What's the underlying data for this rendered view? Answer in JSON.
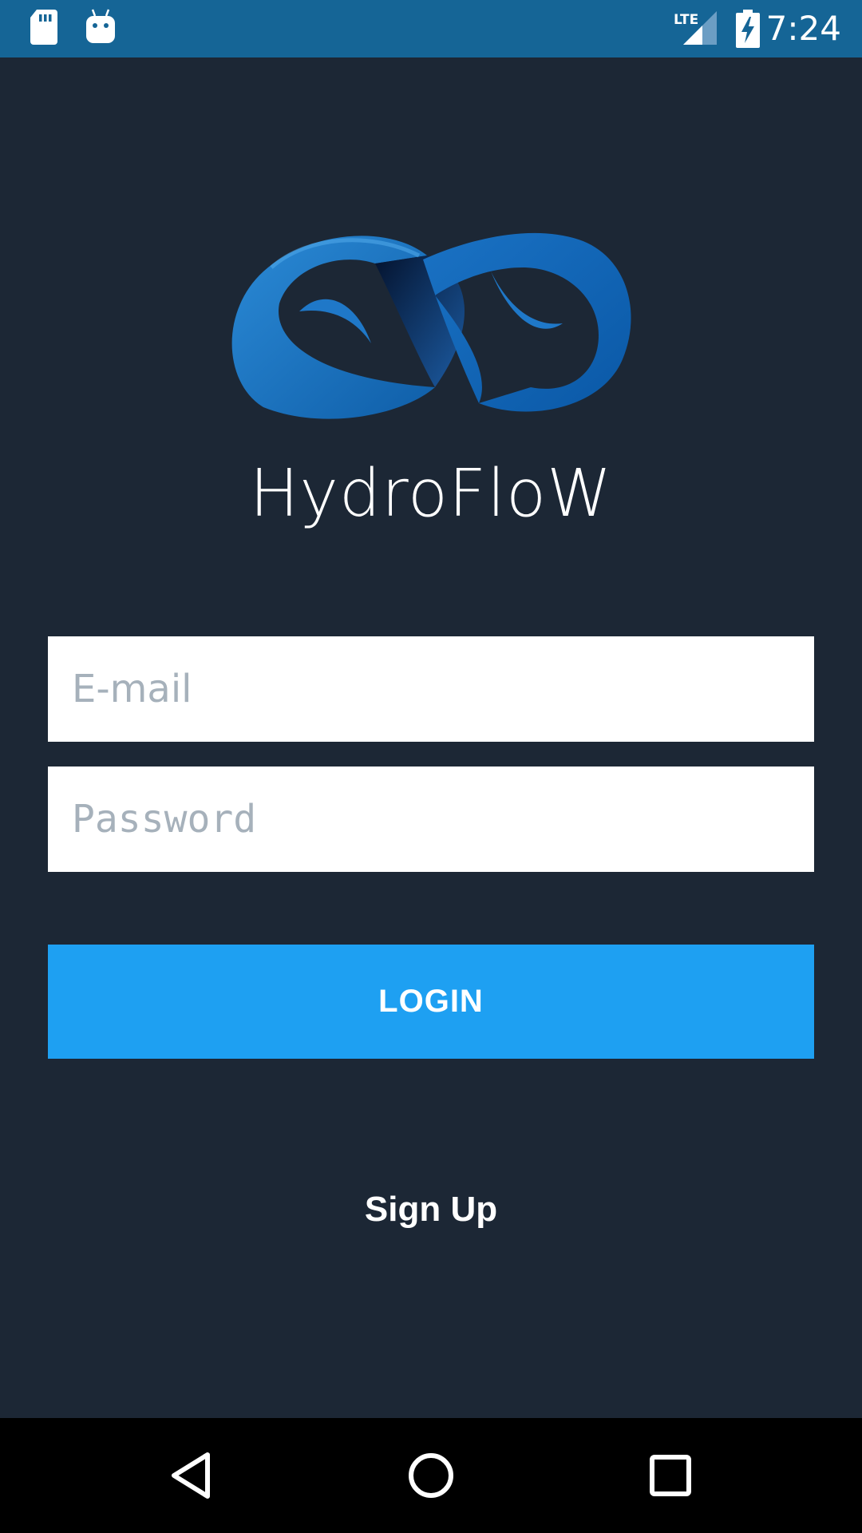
{
  "status_bar": {
    "time": "7:24",
    "network": "LTE",
    "icons": [
      "sd-card-icon",
      "android-debug-icon",
      "lte-signal-icon",
      "battery-charging-icon"
    ]
  },
  "brand": {
    "name": "HydroFloW",
    "logo_icon": "infinity-wave-logo"
  },
  "login_form": {
    "email_placeholder": "E-mail",
    "email_value": "",
    "password_placeholder": "Password",
    "password_value": "",
    "login_label": "LOGIN",
    "signup_label": "Sign Up"
  },
  "nav_bar": {
    "icons": [
      "back-icon",
      "home-icon",
      "recents-icon"
    ]
  },
  "colors": {
    "background": "#1c2735",
    "status_bar": "#156596",
    "accent": "#1ea0f2",
    "placeholder": "#a6b1bb"
  }
}
